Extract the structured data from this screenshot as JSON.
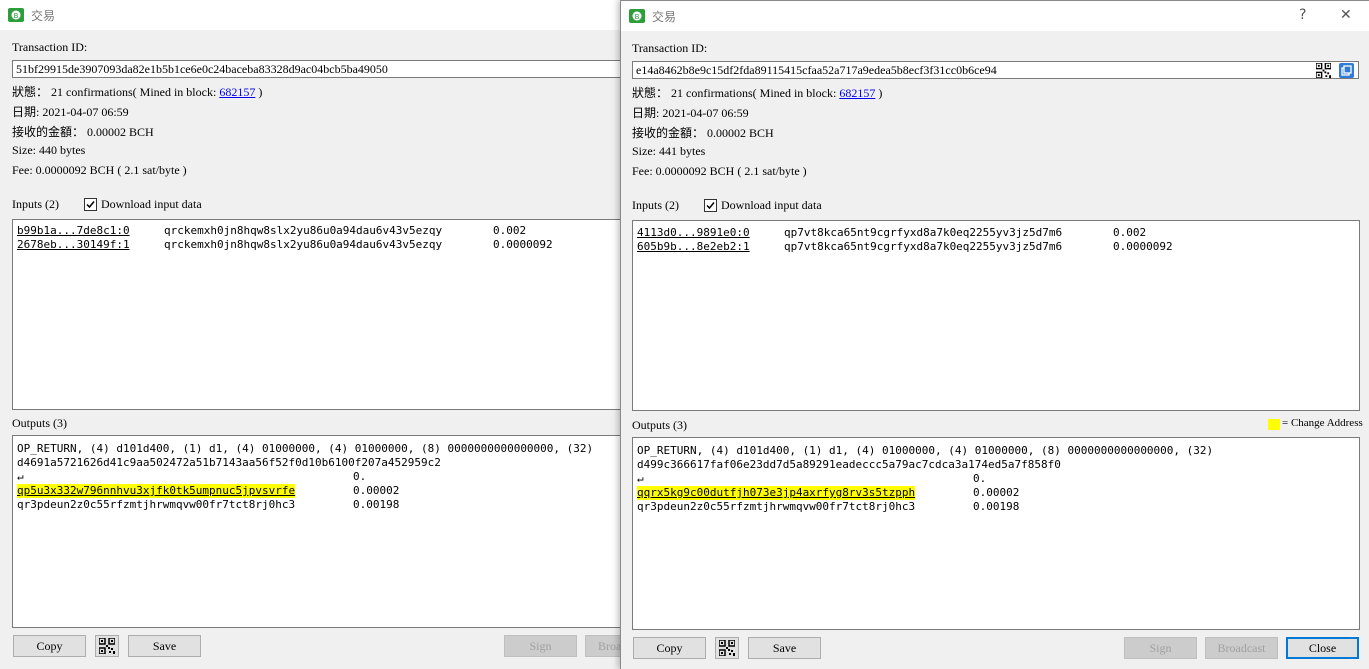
{
  "colors": {
    "highlight": "#ffff00",
    "link": "#0000ee",
    "accent": "#0078d7"
  },
  "win1": {
    "title": "交易",
    "txid_label": "Transaction ID:",
    "txid": "51bf29915de3907093da82e1b5b1ce6e0c24baceba83328d9ac04bcb5ba49050",
    "status_prefix": "狀態： 21 confirmations( Mined in block: ",
    "block": "682157",
    "status_suffix": " )",
    "date": "日期: 2021-04-07 06:59",
    "amount": "接收的金額： 0.00002 BCH",
    "size": "Size: 440 bytes",
    "fee": "Fee: 0.0000092 BCH ( 2.1 sat/byte )",
    "inputs_label": "Inputs (2)",
    "download_label": "Download input data",
    "inputs": [
      {
        "outpoint": "b99b1a...7de8c1:0",
        "address": "qrckemxh0jn8hqw8slx2yu86u0a94dau6v43v5ezqy",
        "amount": "0.002"
      },
      {
        "outpoint": "2678eb...30149f:1",
        "address": "qrckemxh0jn8hqw8slx2yu86u0a94dau6v43v5ezqy",
        "amount": "0.0000092"
      }
    ],
    "outputs_label": "Outputs (3)",
    "op_return_line1": "OP_RETURN, (4) d101d400, (1) d1, (4) 01000000, (4) 01000000, (8) 0000000000000000, (32)",
    "op_return_line2": "d4691a5721626d41c9aa502472a51b7143aa56f52f0d10b6100f207a452959c2",
    "op_return_line3": "↵",
    "op_return_amount": "0.",
    "outputs": [
      {
        "address": "qp5u3x332w796nnhvu3xjfk0tk5umpnuc5jpvsvrfe",
        "amount": "0.00002"
      },
      {
        "address": "qr3pdeun2z0c55rfzmtjhrwmqvw00fr7tct8rj0hc3",
        "amount": "0.00198"
      }
    ],
    "buttons": {
      "copy": "Copy",
      "save": "Save",
      "sign": "Sign",
      "broadcast": "Broa"
    }
  },
  "win2": {
    "title": "交易",
    "help": "?",
    "close_x": "✕",
    "txid_label": "Transaction ID:",
    "txid": "e14a8462b8e9c15df2fda89115415cfaa52a717a9edea5b8ecf3f31cc0b6ce94",
    "status_prefix": "狀態： 21 confirmations( Mined in block: ",
    "block": "682157",
    "status_suffix": " )",
    "date": "日期: 2021-04-07 06:59",
    "amount": "接收的金額： 0.00002 BCH",
    "size": "Size: 441 bytes",
    "fee": "Fee: 0.0000092 BCH ( 2.1 sat/byte )",
    "inputs_label": "Inputs (2)",
    "download_label": "Download input data",
    "inputs": [
      {
        "outpoint": "4113d0...9891e0:0",
        "address": "qp7vt8kca65nt9cgrfyxd8a7k0eq2255yv3jz5d7m6",
        "amount": "0.002"
      },
      {
        "outpoint": "605b9b...8e2eb2:1",
        "address": "qp7vt8kca65nt9cgrfyxd8a7k0eq2255yv3jz5d7m6",
        "amount": "0.0000092"
      }
    ],
    "outputs_label": "Outputs (3)",
    "change_legend": "= Change Address",
    "op_return_line1": "OP_RETURN, (4) d101d400, (1) d1, (4) 01000000, (4) 01000000, (8) 0000000000000000, (32)",
    "op_return_line2": "d499c366617faf06e23dd7d5a89291eadeccc5a79ac7cdca3a174ed5a7f858f0",
    "op_return_line3": "↵",
    "op_return_amount": "0.",
    "outputs": [
      {
        "address": "qqrx5kg9c00dutfjh073e3jp4axrfyg8rv3s5tzpph",
        "amount": "0.00002"
      },
      {
        "address": "qr3pdeun2z0c55rfzmtjhrwmqvw00fr7tct8rj0hc3",
        "amount": "0.00198"
      }
    ],
    "buttons": {
      "copy": "Copy",
      "save": "Save",
      "sign": "Sign",
      "broadcast": "Broadcast",
      "close": "Close"
    }
  }
}
